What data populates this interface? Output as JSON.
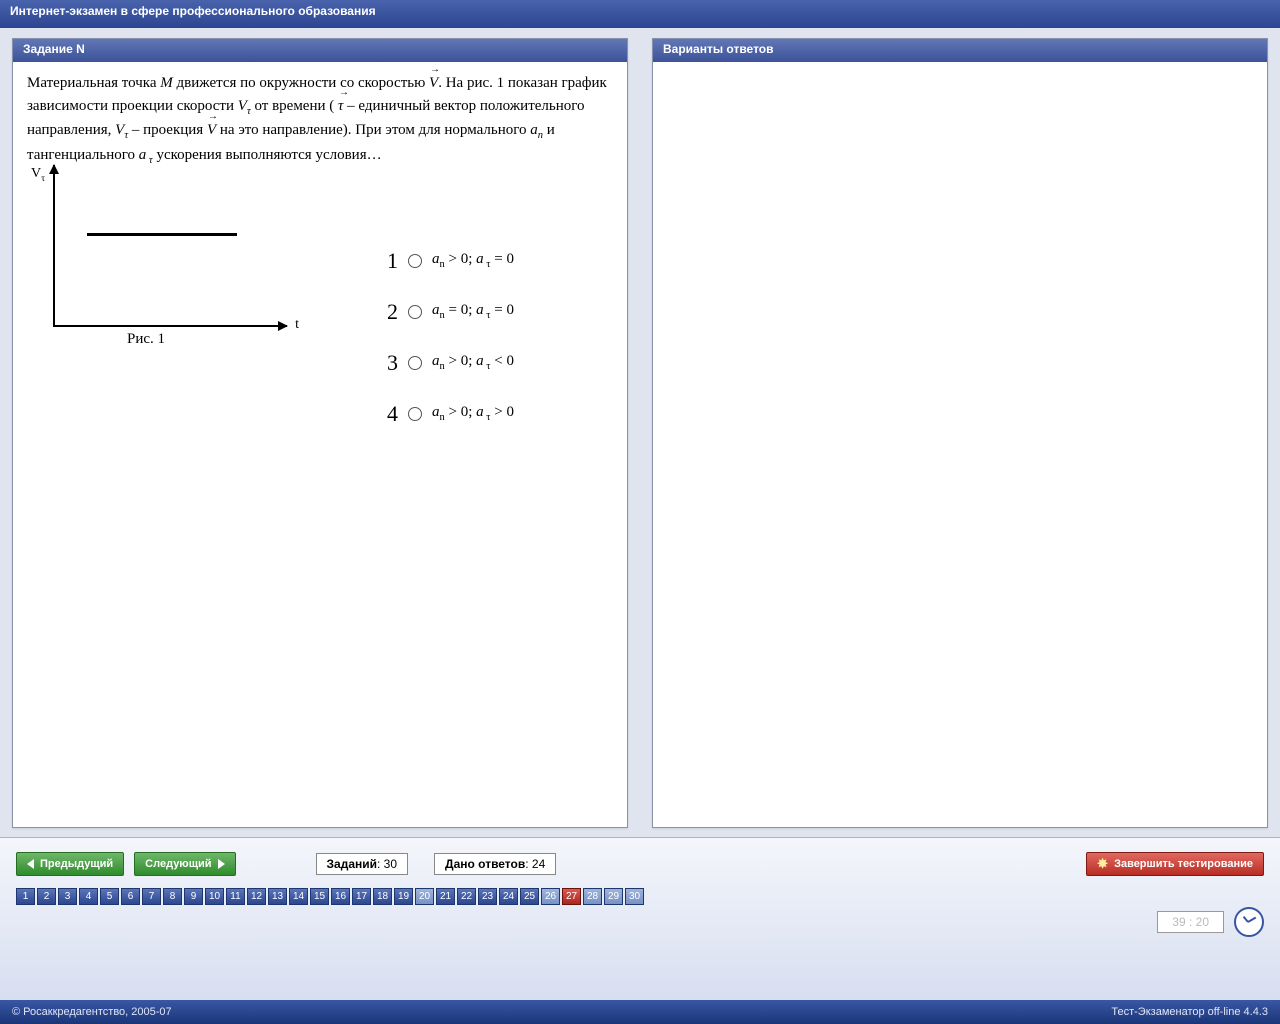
{
  "title": "Интернет-экзамен в сфере профессионального образования",
  "left_panel_title": "Задание N",
  "right_panel_title": "Варианты ответов",
  "question": {
    "t1": "Материальная точка ",
    "M": "M",
    "t2": " движется по окружности со скоростью ",
    "vec_V": "V",
    "t3": ". На рис. 1 показан график зависимости проекции скорости ",
    "Vtau": "V",
    "t4": "  от времени ( ",
    "vec_tau": "τ",
    "t5": " – единичный вектор положительного направления, ",
    "Vtau2": "V",
    "t6": " – проекция ",
    "vec_V2": "V",
    "t7": " на это направление). При этом для нормального ",
    "an": "a",
    "t8": " и тангенциального ",
    "atau": "a",
    "t9": "  ускорения выполняются условия…"
  },
  "fig": {
    "ylabel": "V",
    "ysub": "τ",
    "xlabel": "t",
    "caption": "Рис. 1"
  },
  "answers": [
    {
      "n": "1",
      "l": "aₙ > 0; a τ = 0"
    },
    {
      "n": "2",
      "l": "aₙ = 0; a τ = 0"
    },
    {
      "n": "3",
      "l": "aₙ > 0; a τ < 0"
    },
    {
      "n": "4",
      "l": "aₙ > 0; a τ > 0"
    }
  ],
  "nav": {
    "prev": "Предыдущий",
    "next": "Следующий",
    "total_lbl": "Заданий",
    "total": "30",
    "done_lbl": "Дано ответов",
    "done": "24",
    "finish": "Завершить тестирование"
  },
  "qnav": [
    {
      "n": "1",
      "s": "ans"
    },
    {
      "n": "2",
      "s": "ans"
    },
    {
      "n": "3",
      "s": "ans"
    },
    {
      "n": "4",
      "s": "ans"
    },
    {
      "n": "5",
      "s": "ans"
    },
    {
      "n": "6",
      "s": "ans"
    },
    {
      "n": "7",
      "s": "ans"
    },
    {
      "n": "8",
      "s": "ans"
    },
    {
      "n": "9",
      "s": "ans"
    },
    {
      "n": "10",
      "s": "ans"
    },
    {
      "n": "11",
      "s": "ans"
    },
    {
      "n": "12",
      "s": "ans"
    },
    {
      "n": "13",
      "s": "ans"
    },
    {
      "n": "14",
      "s": "ans"
    },
    {
      "n": "15",
      "s": "ans"
    },
    {
      "n": "16",
      "s": "ans"
    },
    {
      "n": "17",
      "s": "ans"
    },
    {
      "n": "18",
      "s": "ans"
    },
    {
      "n": "19",
      "s": "ans"
    },
    {
      "n": "20",
      "s": "una"
    },
    {
      "n": "21",
      "s": "ans"
    },
    {
      "n": "22",
      "s": "ans"
    },
    {
      "n": "23",
      "s": "ans"
    },
    {
      "n": "24",
      "s": "ans"
    },
    {
      "n": "25",
      "s": "ans"
    },
    {
      "n": "26",
      "s": "una"
    },
    {
      "n": "27",
      "s": "cur"
    },
    {
      "n": "28",
      "s": "una"
    },
    {
      "n": "29",
      "s": "una"
    },
    {
      "n": "30",
      "s": "una"
    }
  ],
  "timer": "39 : 20",
  "footer": {
    "left": "© Росаккредагентство, 2005-07",
    "right": "Тест-Экзаменатор off-line 4.4.3"
  },
  "chart_data": {
    "type": "line",
    "title": "Рис. 1",
    "xlabel": "t",
    "ylabel": "Vτ",
    "series": [
      {
        "name": "Vτ(t)",
        "description": "horizontal constant positive value",
        "x": [
          0,
          1
        ],
        "y": [
          1,
          1
        ]
      }
    ],
    "note": "Vτ is constant and positive over the shown interval"
  }
}
